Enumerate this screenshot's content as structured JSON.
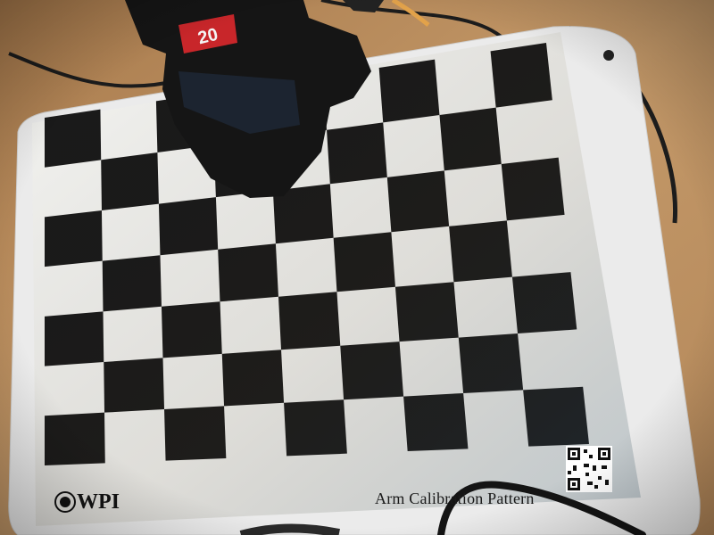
{
  "photo": {
    "board_caption": "Arm Calibration Pattern",
    "logo_text": "WPI",
    "camera_label": "20",
    "checkerboard": {
      "columns": 9,
      "rows": 7
    },
    "colors": {
      "table": "#b88a5a",
      "plate": "#ebebeb",
      "paper": "#f5f5f2",
      "square_dark": "#1a1a1a",
      "cable": "#1c1c1c",
      "camera_body": "#151515"
    }
  }
}
